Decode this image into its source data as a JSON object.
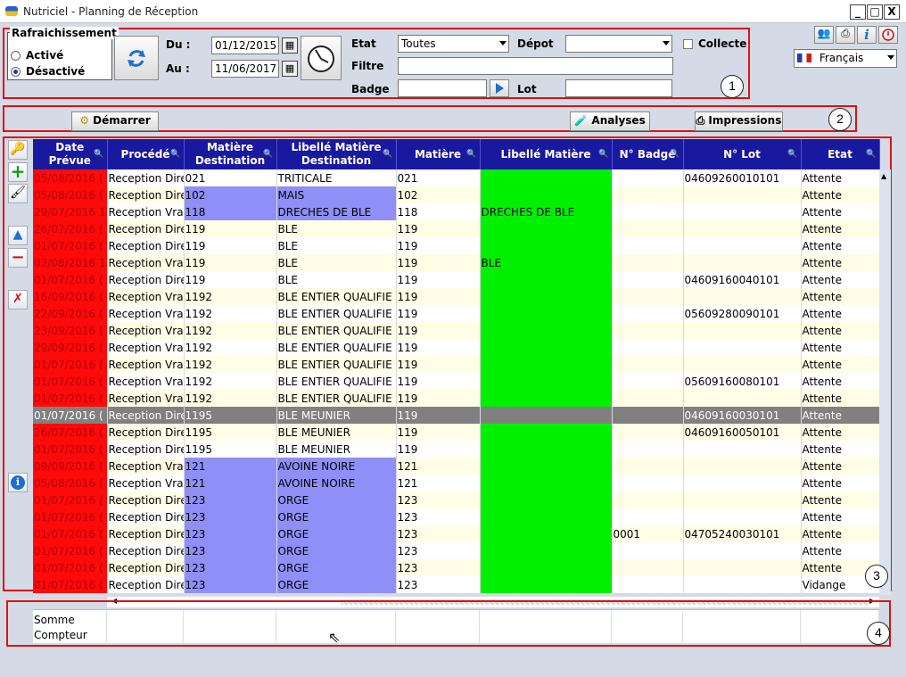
{
  "window": {
    "title": "Nutriciel - Planning de Réception",
    "btn_min": "_",
    "btn_max": "□",
    "btn_close": "X"
  },
  "refresh": {
    "legend": "Rafraichissement",
    "active": "Activé",
    "inactive": "Désactivé"
  },
  "dates": {
    "du_label": "Du :",
    "au_label": "Au :",
    "du_value": "01/12/2015",
    "au_value": "11/06/2017"
  },
  "filters": {
    "etat_label": "Etat",
    "etat_value": "Toutes",
    "depot_label": "Dépot",
    "depot_value": "",
    "collecte_label": "Collecte",
    "filtre_label": "Filtre",
    "filtre_value": "",
    "badge_label": "Badge",
    "badge_value": "",
    "lot_label": "Lot",
    "lot_value": ""
  },
  "language": {
    "value": "Français"
  },
  "toolbar": {
    "start": "Démarrer",
    "analyses": "Analyses",
    "impressions": "Impressions"
  },
  "badges": [
    "1",
    "2",
    "3",
    "4"
  ],
  "columns": [
    {
      "label": "Date Prévue",
      "width": 83
    },
    {
      "label": "Procédé",
      "width": 86
    },
    {
      "label": "Matière Destination",
      "width": 104
    },
    {
      "label": "Libellé Matière Destination",
      "width": 134
    },
    {
      "label": "Matière",
      "width": 94
    },
    {
      "label": "Libellé Matière",
      "width": 148
    },
    {
      "label": "N° Badge",
      "width": 80
    },
    {
      "label": "N° Lot",
      "width": 132
    },
    {
      "label": "Etat",
      "width": 88
    }
  ],
  "rows": [
    {
      "date": "05/08/2016 (",
      "proc": "Reception Dire",
      "mdest": "021",
      "lmdest": "TRITICALE",
      "mat": "021",
      "lmat": "",
      "badge": "",
      "lot": "04609260010101",
      "etat": "Attente",
      "p": 0,
      "g": 1
    },
    {
      "date": "05/08/2016 (",
      "proc": "Reception Dire",
      "mdest": "102",
      "lmdest": "MAIS",
      "mat": "102",
      "lmat": "",
      "badge": "",
      "lot": "",
      "etat": "Attente",
      "p": 1,
      "g": 1
    },
    {
      "date": "29/07/2016 1",
      "proc": "Reception Vra",
      "mdest": "118",
      "lmdest": "DRECHES DE BLE",
      "mat": "118",
      "lmat": "DRECHES DE BLE",
      "badge": "",
      "lot": "",
      "etat": "Attente",
      "p": 1,
      "g": 1
    },
    {
      "date": "26/07/2016 (",
      "proc": "Reception Dire",
      "mdest": "119",
      "lmdest": "BLE",
      "mat": "119",
      "lmat": "",
      "badge": "",
      "lot": "",
      "etat": "Attente",
      "p": 0,
      "g": 1
    },
    {
      "date": "01/07/2016 (",
      "proc": "Reception Dire",
      "mdest": "119",
      "lmdest": "BLE",
      "mat": "119",
      "lmat": "",
      "badge": "",
      "lot": "",
      "etat": "Attente",
      "p": 0,
      "g": 1
    },
    {
      "date": "02/08/2016 1",
      "proc": "Reception Vra",
      "mdest": "119",
      "lmdest": "BLE",
      "mat": "119",
      "lmat": "BLE",
      "badge": "",
      "lot": "",
      "etat": "Attente",
      "p": 0,
      "g": 1
    },
    {
      "date": "01/07/2016 (",
      "proc": "Reception Dire",
      "mdest": "119",
      "lmdest": "BLE",
      "mat": "119",
      "lmat": "",
      "badge": "",
      "lot": "04609160040101",
      "etat": "Attente",
      "p": 0,
      "g": 1
    },
    {
      "date": "16/09/2016 (",
      "proc": "Reception Vra",
      "mdest": "1192",
      "lmdest": "BLE ENTIER QUALIFIE",
      "mat": "119",
      "lmat": "",
      "badge": "",
      "lot": "",
      "etat": "Attente",
      "p": 0,
      "g": 1
    },
    {
      "date": "22/09/2016 (",
      "proc": "Reception Vra",
      "mdest": "1192",
      "lmdest": "BLE ENTIER QUALIFIE",
      "mat": "119",
      "lmat": "",
      "badge": "",
      "lot": "05609280090101",
      "etat": "Attente",
      "p": 0,
      "g": 1
    },
    {
      "date": "23/09/2016 (",
      "proc": "Reception Vra",
      "mdest": "1192",
      "lmdest": "BLE ENTIER QUALIFIE",
      "mat": "119",
      "lmat": "",
      "badge": "",
      "lot": "",
      "etat": "Attente",
      "p": 0,
      "g": 1
    },
    {
      "date": "29/09/2016 (",
      "proc": "Reception Vra",
      "mdest": "1192",
      "lmdest": "BLE ENTIER QUALIFIE",
      "mat": "119",
      "lmat": "",
      "badge": "",
      "lot": "",
      "etat": "Attente",
      "p": 0,
      "g": 1
    },
    {
      "date": "01/07/2016 (",
      "proc": "Reception Vra",
      "mdest": "1192",
      "lmdest": "BLE ENTIER QUALIFIE",
      "mat": "119",
      "lmat": "",
      "badge": "",
      "lot": "",
      "etat": "Attente",
      "p": 0,
      "g": 1
    },
    {
      "date": "01/07/2016 (",
      "proc": "Reception Vra",
      "mdest": "1192",
      "lmdest": "BLE ENTIER QUALIFIE",
      "mat": "119",
      "lmat": "",
      "badge": "",
      "lot": "05609160080101",
      "etat": "Attente",
      "p": 0,
      "g": 1
    },
    {
      "date": "01/07/2016 (",
      "proc": "Reception Vra",
      "mdest": "1192",
      "lmdest": "BLE ENTIER QUALIFIE",
      "mat": "119",
      "lmat": "",
      "badge": "",
      "lot": "",
      "etat": "Attente",
      "p": 0,
      "g": 1
    },
    {
      "date": "01/07/2016 (",
      "proc": "Reception Dire",
      "mdest": "1195",
      "lmdest": "BLE MEUNIER",
      "mat": "119",
      "lmat": "",
      "badge": "",
      "lot": "04609160030101",
      "etat": "Attente",
      "p": 0,
      "g": 0,
      "sel": 1
    },
    {
      "date": "26/07/2016 (",
      "proc": "Reception Dire",
      "mdest": "1195",
      "lmdest": "BLE MEUNIER",
      "mat": "119",
      "lmat": "",
      "badge": "",
      "lot": "04609160050101",
      "etat": "Attente",
      "p": 0,
      "g": 1
    },
    {
      "date": "01/07/2016 (",
      "proc": "Reception Dire",
      "mdest": "1195",
      "lmdest": "BLE MEUNIER",
      "mat": "119",
      "lmat": "",
      "badge": "",
      "lot": "",
      "etat": "Attente",
      "p": 0,
      "g": 1
    },
    {
      "date": "09/09/2016 (",
      "proc": "Reception Vra",
      "mdest": "121",
      "lmdest": "AVOINE NOIRE",
      "mat": "121",
      "lmat": "",
      "badge": "",
      "lot": "",
      "etat": "Attente",
      "p": 1,
      "g": 1
    },
    {
      "date": "05/08/2016 (",
      "proc": "Reception Vra",
      "mdest": "121",
      "lmdest": "AVOINE NOIRE",
      "mat": "121",
      "lmat": "",
      "badge": "",
      "lot": "",
      "etat": "Attente",
      "p": 1,
      "g": 1
    },
    {
      "date": "01/07/2016 (",
      "proc": "Reception Dire",
      "mdest": "123",
      "lmdest": "ORGE",
      "mat": "123",
      "lmat": "",
      "badge": "",
      "lot": "",
      "etat": "Attente",
      "p": 1,
      "g": 1
    },
    {
      "date": "01/07/2016 (",
      "proc": "Reception Dire",
      "mdest": "123",
      "lmdest": "ORGE",
      "mat": "123",
      "lmat": "",
      "badge": "",
      "lot": "",
      "etat": "Attente",
      "p": 1,
      "g": 1
    },
    {
      "date": "01/07/2016 (",
      "proc": "Reception Dire",
      "mdest": "123",
      "lmdest": "ORGE",
      "mat": "123",
      "lmat": "",
      "badge": "0001",
      "lot": "04705240030101",
      "etat": "Attente",
      "p": 1,
      "g": 1
    },
    {
      "date": "01/07/2016 (",
      "proc": "Reception Dire",
      "mdest": "123",
      "lmdest": "ORGE",
      "mat": "123",
      "lmat": "",
      "badge": "",
      "lot": "",
      "etat": "Attente",
      "p": 1,
      "g": 1
    },
    {
      "date": "01/07/2016 (",
      "proc": "Reception Dire",
      "mdest": "123",
      "lmdest": "ORGE",
      "mat": "123",
      "lmat": "",
      "badge": "",
      "lot": "",
      "etat": "Attente",
      "p": 1,
      "g": 1
    },
    {
      "date": "01/07/2016 (",
      "proc": "Reception Dire",
      "mdest": "123",
      "lmdest": "ORGE",
      "mat": "123",
      "lmat": "",
      "badge": "",
      "lot": "",
      "etat": "Vidange",
      "p": 1,
      "g": 1
    }
  ],
  "footer": {
    "somme": "Somme",
    "compteur": "Compteur"
  },
  "colors": {
    "header": "#1919a0",
    "date_cell": "#ff0a0a",
    "purple_cell": "#8f8ff7",
    "green_cell": "#00f000",
    "selected_row": "#808080",
    "panel_border": "#e01010"
  }
}
